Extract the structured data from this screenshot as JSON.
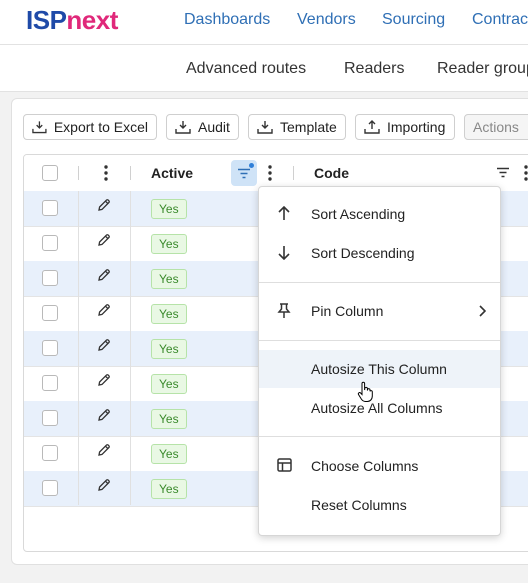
{
  "brand": {
    "part1": "ISP",
    "part2": "next"
  },
  "topnav": [
    "Dashboards",
    "Vendors",
    "Sourcing",
    "Contrac"
  ],
  "subnav": [
    "Advanced routes",
    "Readers",
    "Reader group"
  ],
  "toolbar": {
    "export": "Export to Excel",
    "audit": "Audit",
    "template": "Template",
    "importing": "Importing",
    "actions": "Actions"
  },
  "grid": {
    "columns": {
      "active": "Active",
      "code": "Code"
    },
    "rows": [
      {
        "active": "Yes"
      },
      {
        "active": "Yes"
      },
      {
        "active": "Yes"
      },
      {
        "active": "Yes"
      },
      {
        "active": "Yes"
      },
      {
        "active": "Yes"
      },
      {
        "active": "Yes"
      },
      {
        "active": "Yes"
      },
      {
        "active": "Yes"
      }
    ]
  },
  "column_menu": {
    "sort_asc": "Sort Ascending",
    "sort_desc": "Sort Descending",
    "pin": "Pin Column",
    "autosize_this": "Autosize This Column",
    "autosize_all": "Autosize All Columns",
    "choose": "Choose Columns",
    "reset": "Reset Columns"
  },
  "colors": {
    "brand_blue": "#1f4aa8",
    "brand_pink": "#e0287a",
    "row_alt": "#e8f0fb",
    "badge_green": "#3a8a2c"
  }
}
